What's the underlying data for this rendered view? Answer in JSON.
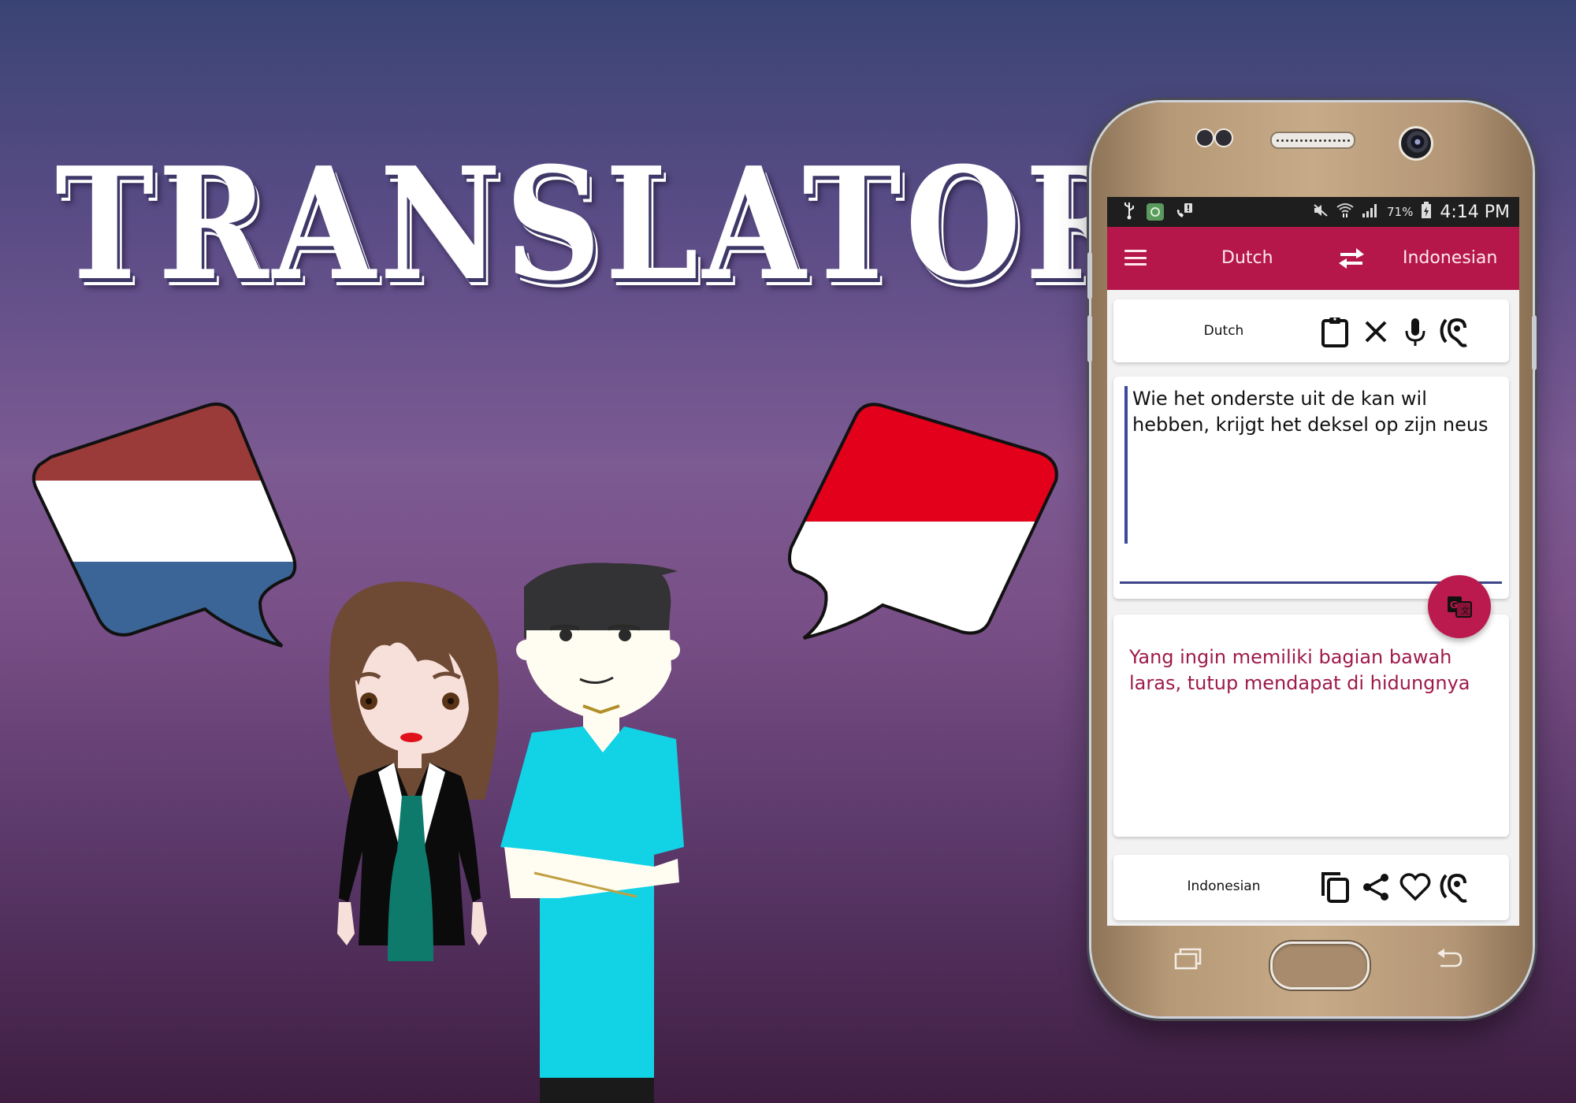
{
  "banner": {
    "title": "TRANSLATOR"
  },
  "illustration": {
    "source_flag": "netherlands-flag-speech-bubble",
    "target_flag": "indonesia-flag-speech-bubble",
    "characters": [
      "woman-character",
      "man-character"
    ],
    "colors": {
      "nl_red": "#9a3b3a",
      "nl_white": "#ffffff",
      "nl_blue": "#3b6596",
      "id_red": "#e2001a",
      "id_white": "#ffffff"
    }
  },
  "status_bar": {
    "left_icons": [
      "usb-icon",
      "app-notification-icon",
      "missed-call-icon"
    ],
    "right_icons": [
      "mute-icon",
      "wifi-icon",
      "signal-icon"
    ],
    "battery_percent": "71%",
    "time": "4:14 PM"
  },
  "app_bar": {
    "menu_icon": "hamburger-menu-icon",
    "source_language": "Dutch",
    "swap_icon": "swap-arrows-icon",
    "target_language": "Indonesian",
    "accent_color": "#b5174b"
  },
  "source_toolbar": {
    "language_label": "Dutch",
    "icons": [
      "clipboard-icon",
      "close-icon",
      "microphone-icon",
      "listen-ear-icon"
    ]
  },
  "input": {
    "value": "Wie het onderste uit de kan wil hebben, krijgt het deksel op zijn neus",
    "placeholder": ""
  },
  "translate_button": {
    "icon": "google-translate-icon"
  },
  "output": {
    "text": "Yang ingin memiliki bagian bawah laras, tutup mendapat di hidungnya",
    "text_color": "#9e1a4a"
  },
  "target_toolbar": {
    "language_label": "Indonesian",
    "icons": [
      "copy-icon",
      "share-icon",
      "favorite-heart-icon",
      "listen-ear-icon"
    ]
  },
  "nav_bar": {
    "buttons": [
      "recent-apps-icon",
      "home-button",
      "back-icon"
    ]
  }
}
